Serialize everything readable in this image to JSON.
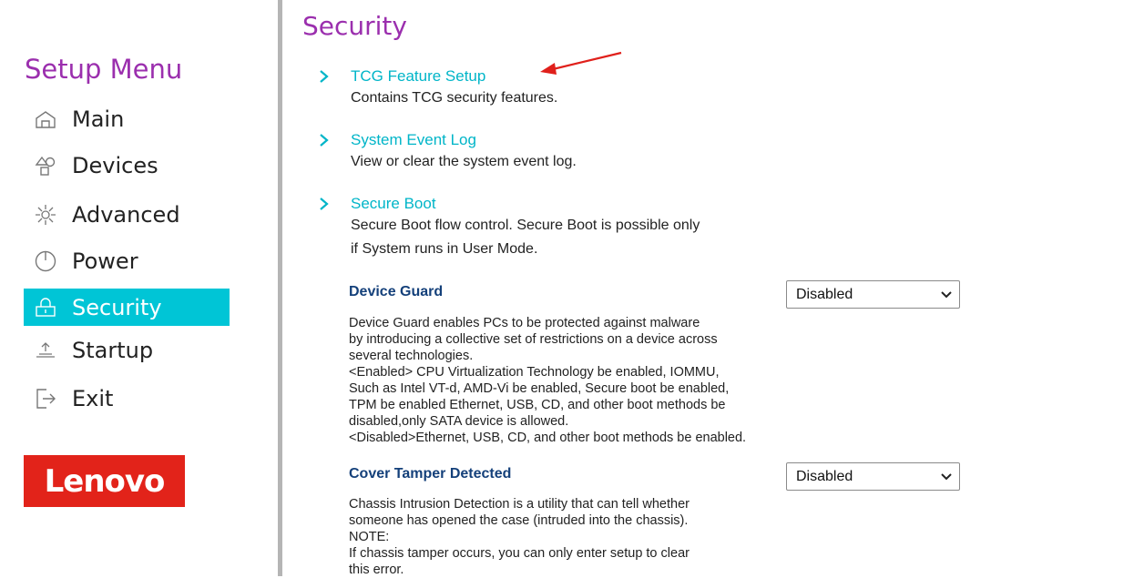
{
  "sidebar": {
    "title": "Setup Menu",
    "items": [
      {
        "label": "Main",
        "icon": "home-icon",
        "active": false
      },
      {
        "label": "Devices",
        "icon": "devices-icon",
        "active": false
      },
      {
        "label": "Advanced",
        "icon": "advanced-icon",
        "active": false
      },
      {
        "label": "Power",
        "icon": "power-icon",
        "active": false
      },
      {
        "label": "Security",
        "icon": "security-icon",
        "active": true
      },
      {
        "label": "Startup",
        "icon": "startup-icon",
        "active": false
      },
      {
        "label": "Exit",
        "icon": "exit-icon",
        "active": false
      }
    ],
    "logo_text": "Lenovo"
  },
  "main": {
    "title": "Security",
    "submenus": [
      {
        "label": "TCG Feature Setup",
        "desc_lines": [
          "Contains TCG security features."
        ]
      },
      {
        "label": "System Event Log",
        "desc_lines": [
          "View or clear the system event log."
        ]
      },
      {
        "label": "Secure Boot",
        "desc_lines": [
          "Secure Boot flow control. Secure Boot is possible only",
          "if System runs in User Mode."
        ]
      }
    ],
    "settings": [
      {
        "label": "Device Guard",
        "value": "Disabled",
        "desc_lines": [
          "Device Guard enables PCs to be protected against malware",
          "by introducing a collective set of restrictions on a device across",
          "several technologies.",
          "<Enabled> CPU Virtualization Technology be enabled, IOMMU,",
          "Such as Intel VT-d, AMD-Vi be enabled, Secure boot be enabled,",
          "TPM be enabled Ethernet, USB, CD, and other boot methods be",
          "disabled,only SATA device is allowed.",
          "<Disabled>Ethernet, USB, CD, and other boot methods be enabled."
        ]
      },
      {
        "label": "Cover Tamper Detected",
        "value": "Disabled",
        "desc_lines": [
          "Chassis Intrusion Detection is a utility that can tell whether",
          "someone has opened the case (intruded into the chassis).",
          "NOTE:",
          "If chassis tamper occurs, you can only enter setup to clear",
          "this error."
        ]
      }
    ]
  },
  "colors": {
    "accent_purple": "#9b2fae",
    "accent_cyan": "#00c5d6",
    "link_cyan": "#00b5c8",
    "setting_label_blue": "#14407a",
    "logo_red": "#e2231a",
    "annotation_arrow": "#e0201b"
  }
}
